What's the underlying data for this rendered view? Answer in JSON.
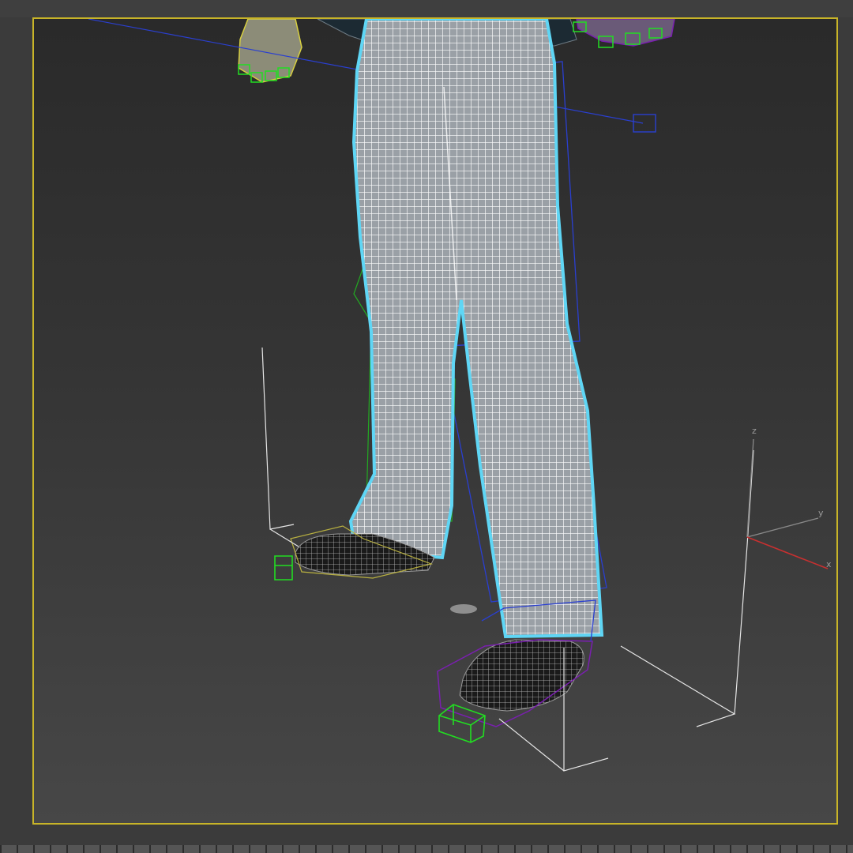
{
  "viewport": {
    "border_color": "#c8b428",
    "background_top": "#2a2a2a",
    "background_bottom": "#474747"
  },
  "scene": {
    "selected_mesh_color": "#5fd6f5",
    "wireframe_color": "#ffffff",
    "bone_green": "#22dd22",
    "bone_blue": "#2a3fd0",
    "bone_purple": "#7a1fb0",
    "bone_yellow": "#d8d040"
  },
  "axis_gizmo": {
    "labels": {
      "z": "z",
      "y": "y",
      "x": "x"
    },
    "colors": {
      "x": "#c83030",
      "y": "#8a8a8a",
      "z": "#8a8a8a"
    }
  }
}
